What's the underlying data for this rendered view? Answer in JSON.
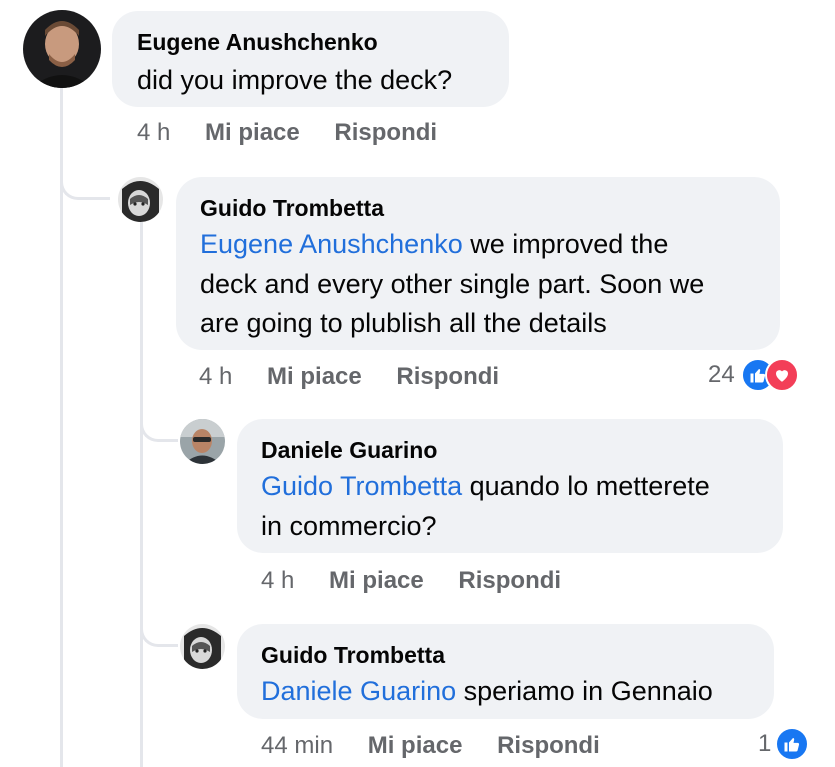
{
  "comments": [
    {
      "author": "Eugene Anushchenko",
      "mention": "",
      "text": "did you improve the deck?",
      "time": "4 h",
      "like_label": "Mi piace",
      "reply_label": "Rispondi"
    },
    {
      "author": "Guido Trombetta",
      "mention": "Eugene Anushchenko",
      "line1": " we improved the",
      "line2": "deck and every other single part. Soon we",
      "line3": "are going to plublish all the details",
      "time": "4 h",
      "like_label": "Mi piace",
      "reply_label": "Rispondi",
      "reaction_count": "24",
      "reactions": [
        "like-icon",
        "love-icon"
      ]
    },
    {
      "author": "Daniele Guarino",
      "mention": "Guido Trombetta",
      "line1": " quando lo metterete",
      "line2": "in commercio?",
      "time": "4 h",
      "like_label": "Mi piace",
      "reply_label": "Rispondi"
    },
    {
      "author": "Guido Trombetta",
      "mention": "Daniele Guarino",
      "line1": " speriamo in Gennaio",
      "time": "44 min",
      "like_label": "Mi piace",
      "reply_label": "Rispondi",
      "reaction_count": "1",
      "reactions": [
        "like-icon"
      ]
    }
  ],
  "colors": {
    "bubble": "#f0f2f5",
    "mention": "#216fdb",
    "meta": "#65676b",
    "like": "#1877f2",
    "love": "#f33e58"
  }
}
